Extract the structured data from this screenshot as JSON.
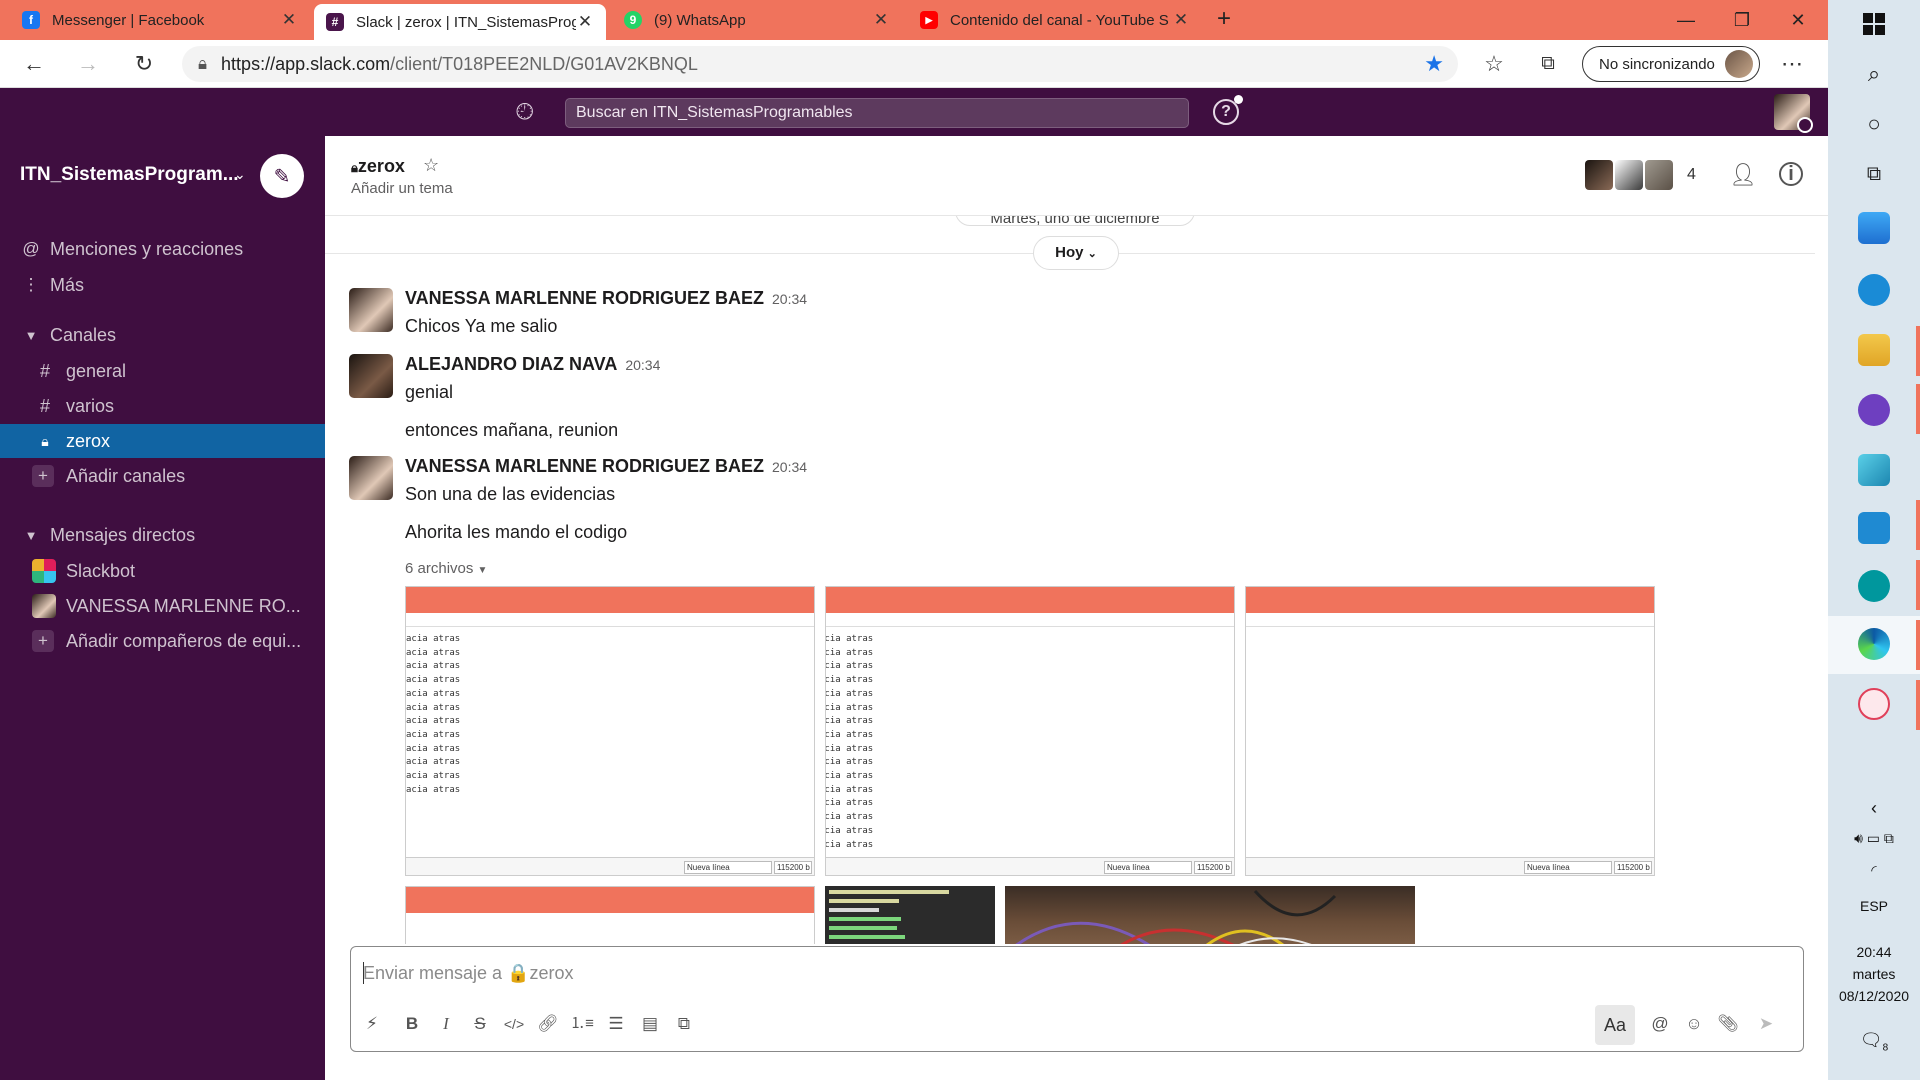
{
  "browser": {
    "tabs": [
      {
        "title": "Messenger | Facebook",
        "color": "#1877f2",
        "glyph": "f"
      },
      {
        "title": "Slack | zerox | ITN_SistemasProgr",
        "color": "#4a154b",
        "glyph": "#"
      },
      {
        "title": "(9) WhatsApp",
        "color": "#25d366",
        "glyph": "9"
      },
      {
        "title": "Contenido del canal - YouTube S",
        "color": "#ff0000",
        "glyph": "▶"
      }
    ],
    "url_host": "https://app.slack.com",
    "url_path": "/client/T018PEE2NLD/G01AV2KBNQL",
    "sync_label": "No sincronizando"
  },
  "slack": {
    "search_placeholder": "Buscar en ITN_SistemasProgramables",
    "workspace_name": "ITN_SistemasProgram...",
    "sidebar": {
      "mentions": "Menciones y reacciones",
      "more": "Más",
      "channels_header": "Canales",
      "channels": [
        "general",
        "varios",
        "zerox"
      ],
      "add_channels": "Añadir canales",
      "dm_header": "Mensajes directos",
      "dms": [
        "Slackbot",
        "VANESSA MARLENNE RO..."
      ],
      "add_teammates": "Añadir compañeros de equi..."
    },
    "channel": {
      "name": "zerox",
      "topic": "Añadir un tema",
      "member_count": "4"
    },
    "day_divider_old": "Martes, uno de diciembre",
    "day_divider": "Hoy",
    "messages": [
      {
        "author": "VANESSA MARLENNE RODRIGUEZ BAEZ",
        "time": "20:34",
        "text": "Chicos Ya me salio"
      },
      {
        "author": "ALEJANDRO DIAZ NAVA",
        "time": "20:34",
        "text": "genial",
        "text2": "entonces mañana, reunion"
      },
      {
        "author": "VANESSA MARLENNE RODRIGUEZ BAEZ",
        "time": "20:34",
        "text": "Son una de las evidencias",
        "text2": "Ahorita les mando el codigo"
      }
    ],
    "files_label": "6 archivos",
    "thumb_line": "acia atras",
    "thumb_select": "Nueva línea",
    "thumb_baud": "115200 b",
    "composer_placeholder": "Enviar mensaje a 🔒zerox",
    "composer_aa": "Aa"
  },
  "taskbar": {
    "lang": "ESP",
    "time": "20:44",
    "day": "martes",
    "date": "08/12/2020",
    "notif_count": "8"
  }
}
